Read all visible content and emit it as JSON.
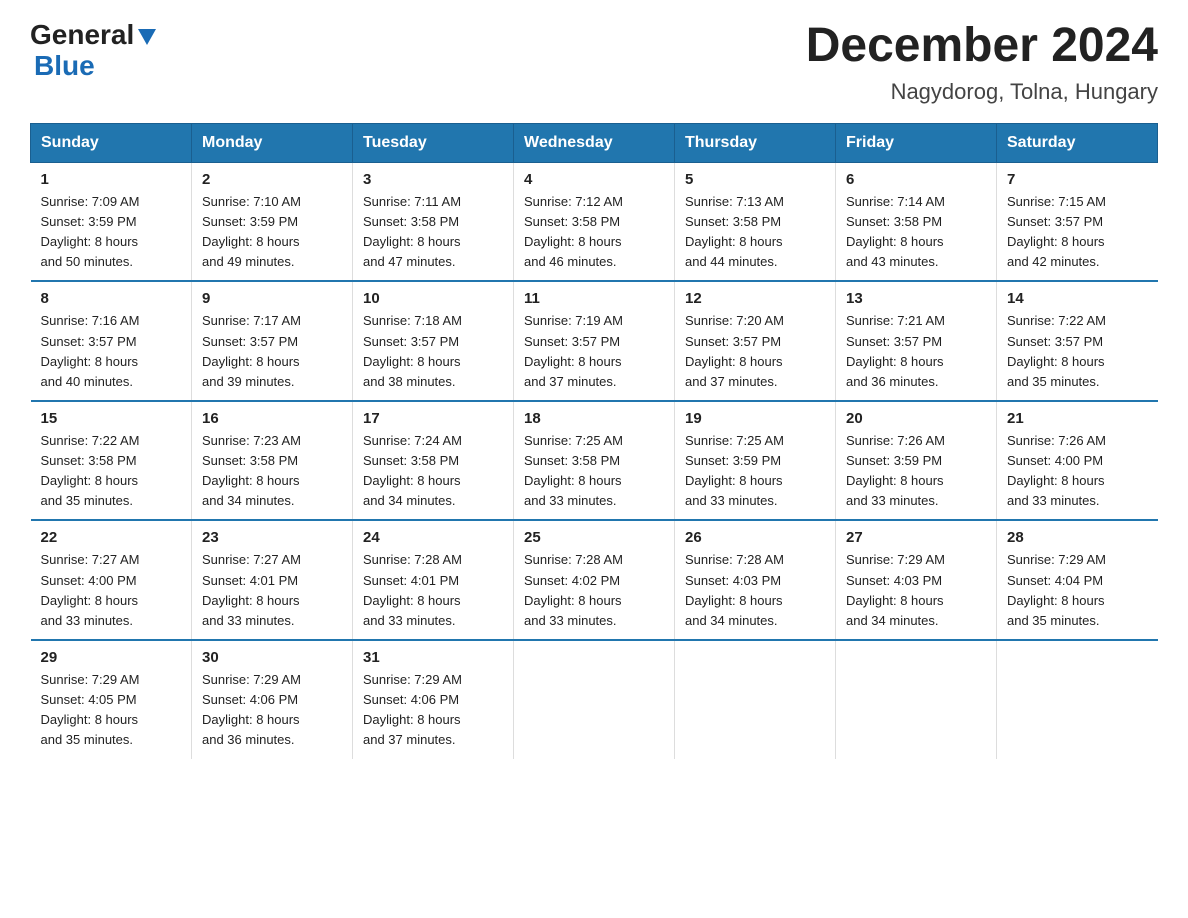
{
  "header": {
    "logo_general": "General",
    "logo_blue": "Blue",
    "month_title": "December 2024",
    "location": "Nagydorog, Tolna, Hungary"
  },
  "weekdays": [
    "Sunday",
    "Monday",
    "Tuesday",
    "Wednesday",
    "Thursday",
    "Friday",
    "Saturday"
  ],
  "weeks": [
    [
      {
        "day": "1",
        "sunrise": "7:09 AM",
        "sunset": "3:59 PM",
        "daylight": "8 hours and 50 minutes."
      },
      {
        "day": "2",
        "sunrise": "7:10 AM",
        "sunset": "3:59 PM",
        "daylight": "8 hours and 49 minutes."
      },
      {
        "day": "3",
        "sunrise": "7:11 AM",
        "sunset": "3:58 PM",
        "daylight": "8 hours and 47 minutes."
      },
      {
        "day": "4",
        "sunrise": "7:12 AM",
        "sunset": "3:58 PM",
        "daylight": "8 hours and 46 minutes."
      },
      {
        "day": "5",
        "sunrise": "7:13 AM",
        "sunset": "3:58 PM",
        "daylight": "8 hours and 44 minutes."
      },
      {
        "day": "6",
        "sunrise": "7:14 AM",
        "sunset": "3:58 PM",
        "daylight": "8 hours and 43 minutes."
      },
      {
        "day": "7",
        "sunrise": "7:15 AM",
        "sunset": "3:57 PM",
        "daylight": "8 hours and 42 minutes."
      }
    ],
    [
      {
        "day": "8",
        "sunrise": "7:16 AM",
        "sunset": "3:57 PM",
        "daylight": "8 hours and 40 minutes."
      },
      {
        "day": "9",
        "sunrise": "7:17 AM",
        "sunset": "3:57 PM",
        "daylight": "8 hours and 39 minutes."
      },
      {
        "day": "10",
        "sunrise": "7:18 AM",
        "sunset": "3:57 PM",
        "daylight": "8 hours and 38 minutes."
      },
      {
        "day": "11",
        "sunrise": "7:19 AM",
        "sunset": "3:57 PM",
        "daylight": "8 hours and 37 minutes."
      },
      {
        "day": "12",
        "sunrise": "7:20 AM",
        "sunset": "3:57 PM",
        "daylight": "8 hours and 37 minutes."
      },
      {
        "day": "13",
        "sunrise": "7:21 AM",
        "sunset": "3:57 PM",
        "daylight": "8 hours and 36 minutes."
      },
      {
        "day": "14",
        "sunrise": "7:22 AM",
        "sunset": "3:57 PM",
        "daylight": "8 hours and 35 minutes."
      }
    ],
    [
      {
        "day": "15",
        "sunrise": "7:22 AM",
        "sunset": "3:58 PM",
        "daylight": "8 hours and 35 minutes."
      },
      {
        "day": "16",
        "sunrise": "7:23 AM",
        "sunset": "3:58 PM",
        "daylight": "8 hours and 34 minutes."
      },
      {
        "day": "17",
        "sunrise": "7:24 AM",
        "sunset": "3:58 PM",
        "daylight": "8 hours and 34 minutes."
      },
      {
        "day": "18",
        "sunrise": "7:25 AM",
        "sunset": "3:58 PM",
        "daylight": "8 hours and 33 minutes."
      },
      {
        "day": "19",
        "sunrise": "7:25 AM",
        "sunset": "3:59 PM",
        "daylight": "8 hours and 33 minutes."
      },
      {
        "day": "20",
        "sunrise": "7:26 AM",
        "sunset": "3:59 PM",
        "daylight": "8 hours and 33 minutes."
      },
      {
        "day": "21",
        "sunrise": "7:26 AM",
        "sunset": "4:00 PM",
        "daylight": "8 hours and 33 minutes."
      }
    ],
    [
      {
        "day": "22",
        "sunrise": "7:27 AM",
        "sunset": "4:00 PM",
        "daylight": "8 hours and 33 minutes."
      },
      {
        "day": "23",
        "sunrise": "7:27 AM",
        "sunset": "4:01 PM",
        "daylight": "8 hours and 33 minutes."
      },
      {
        "day": "24",
        "sunrise": "7:28 AM",
        "sunset": "4:01 PM",
        "daylight": "8 hours and 33 minutes."
      },
      {
        "day": "25",
        "sunrise": "7:28 AM",
        "sunset": "4:02 PM",
        "daylight": "8 hours and 33 minutes."
      },
      {
        "day": "26",
        "sunrise": "7:28 AM",
        "sunset": "4:03 PM",
        "daylight": "8 hours and 34 minutes."
      },
      {
        "day": "27",
        "sunrise": "7:29 AM",
        "sunset": "4:03 PM",
        "daylight": "8 hours and 34 minutes."
      },
      {
        "day": "28",
        "sunrise": "7:29 AM",
        "sunset": "4:04 PM",
        "daylight": "8 hours and 35 minutes."
      }
    ],
    [
      {
        "day": "29",
        "sunrise": "7:29 AM",
        "sunset": "4:05 PM",
        "daylight": "8 hours and 35 minutes."
      },
      {
        "day": "30",
        "sunrise": "7:29 AM",
        "sunset": "4:06 PM",
        "daylight": "8 hours and 36 minutes."
      },
      {
        "day": "31",
        "sunrise": "7:29 AM",
        "sunset": "4:06 PM",
        "daylight": "8 hours and 37 minutes."
      },
      null,
      null,
      null,
      null
    ]
  ],
  "labels": {
    "sunrise": "Sunrise:",
    "sunset": "Sunset:",
    "daylight": "Daylight:"
  }
}
